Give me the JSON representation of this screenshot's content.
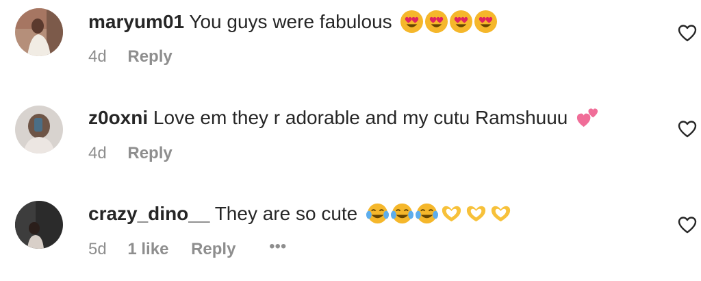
{
  "comments": [
    {
      "username": "maryum01",
      "text": "You guys were fabulous",
      "emojis": [
        "heart-eyes-emoji",
        "heart-eyes-emoji",
        "heart-eyes-emoji",
        "heart-eyes-emoji"
      ],
      "time": "4d",
      "reply_label": "Reply"
    },
    {
      "username": "z0oxni",
      "text": "Love em they r adorable and my cutu Ramshuuu",
      "emojis": [
        "two-hearts-emoji"
      ],
      "time": "4d",
      "reply_label": "Reply"
    },
    {
      "username": "crazy_dino__",
      "text": "They are so cute",
      "emojis": [
        "tears-of-joy-emoji",
        "tears-of-joy-emoji",
        "tears-of-joy-emoji",
        "heart-hands-emoji",
        "heart-hands-emoji",
        "heart-hands-emoji"
      ],
      "time": "5d",
      "likes_label": "1 like",
      "reply_label": "Reply",
      "more_label": "•••"
    }
  ],
  "colors": {
    "text": "#262626",
    "secondary": "#8e8e8e"
  }
}
